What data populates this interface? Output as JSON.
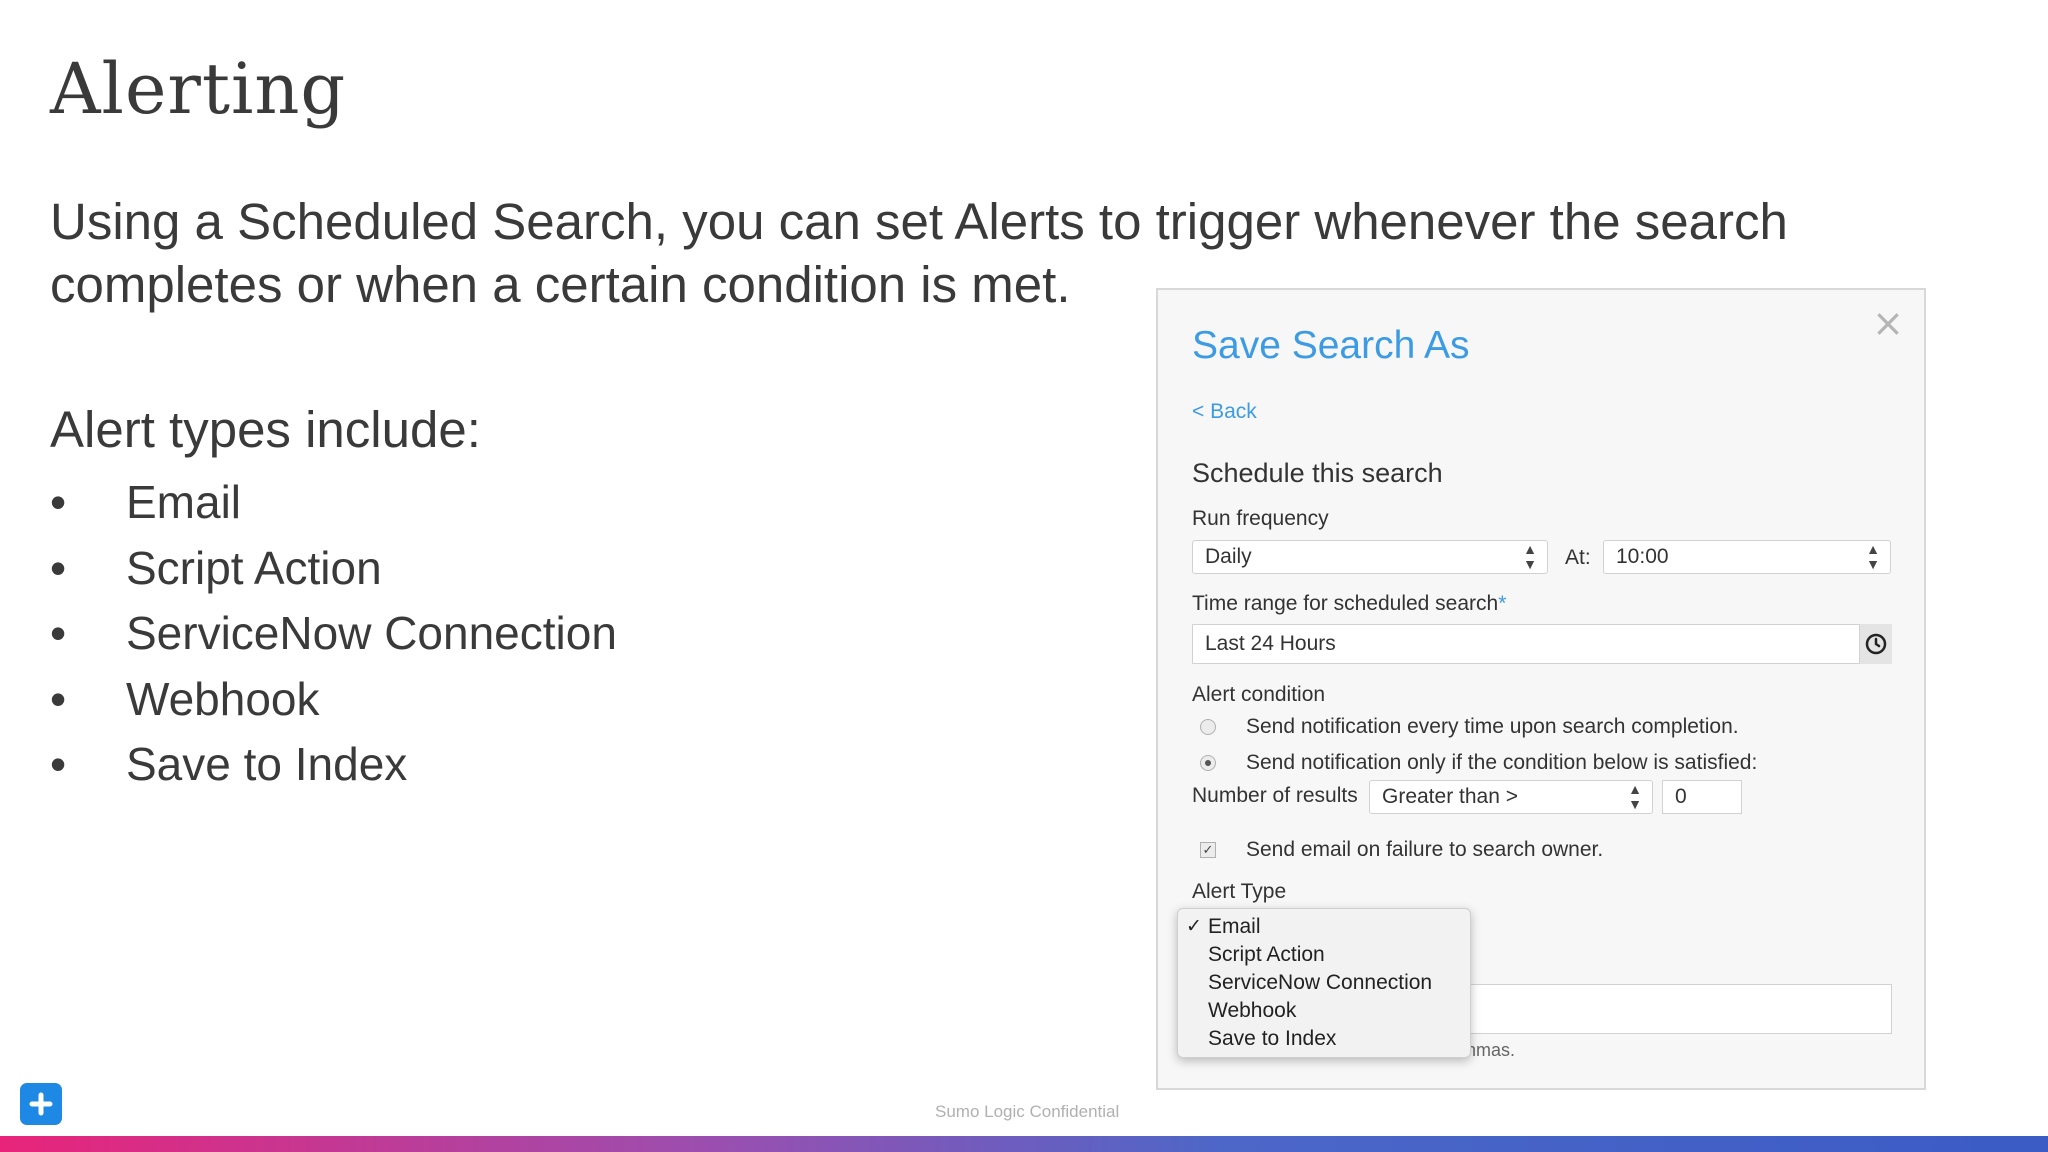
{
  "slide": {
    "title": "Alerting",
    "intro": "Using a Scheduled Search, you can set Alerts to trigger whenever the search completes or when a certain condition is met.",
    "types_heading": "Alert types include:",
    "bullets": [
      "Email",
      "Script Action",
      "ServiceNow Connection",
      "Webhook",
      "Save to Index"
    ],
    "bullet_glyph": "•",
    "footer": "Sumo Logic  Confidential"
  },
  "dialog": {
    "title": "Save Search As",
    "close_glyph": "×",
    "back_label": "< Back",
    "section_title": "Schedule this search",
    "run_frequency": {
      "label": "Run frequency",
      "value": "Daily",
      "at_label": "At:",
      "at_value": "10:00"
    },
    "time_range": {
      "label": "Time range for scheduled search",
      "required_mark": "*",
      "value": "Last 24 Hours",
      "icon": "clock-icon"
    },
    "alert_condition": {
      "label": "Alert condition",
      "options": [
        "Send notification every time upon search completion.",
        "Send notification only if the condition below is satisfied:"
      ],
      "selected_index": 1,
      "results_label": "Number of results",
      "comparator": "Greater than >",
      "threshold": "0",
      "email_on_failure": "Send email on failure to search owner.",
      "email_on_failure_checked": true
    },
    "alert_type": {
      "label": "Alert Type",
      "options": [
        "Email",
        "Script Action",
        "ServiceNow Connection",
        "Webhook",
        "Save to Index"
      ],
      "selected": "Email",
      "check_glyph": "✓",
      "hidden_hint_fragment": "nmas."
    }
  },
  "colors": {
    "accent": "#3d9be3",
    "plus_button": "#1e88e5",
    "bar_start": "#e8247a",
    "bar_end": "#3b5bc5"
  }
}
